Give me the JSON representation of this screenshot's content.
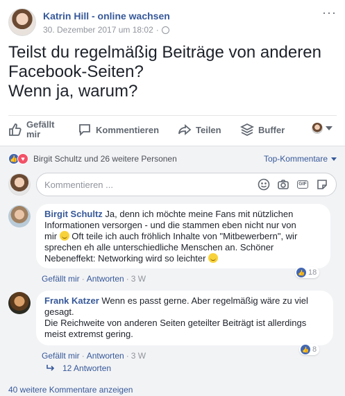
{
  "post": {
    "author": "Katrin Hill - online wachsen",
    "date": "30. Dezember 2017 um 18:02",
    "separator": "·",
    "more": "···",
    "text_lines": [
      "Teilst du regelmäßig Beiträge von anderen",
      "Facebook-Seiten?",
      "Wenn ja, warum?"
    ]
  },
  "actions": {
    "like_line1": "Gefällt",
    "like_line2": "mir",
    "comment": "Kommentieren",
    "share": "Teilen",
    "buffer": "Buffer"
  },
  "reactions": {
    "summary": "Birgit Schultz und 26 weitere Personen",
    "sort": "Top-Kommentare"
  },
  "comment_box": {
    "placeholder": "Kommentieren ..."
  },
  "comments": [
    {
      "name": "Birgit Schultz",
      "line1": " Ja, denn ich möchte meine Fans mit nützlichen",
      "line2": "Informationen versorgen - und die stammen eben nicht nur von",
      "line3a": "mir ",
      "line3b": " Oft teile ich auch fröhlich Inhalte von \"Mitbewerbern\", wir",
      "line4": "sprechen eh alle unterschiedliche Menschen an. Schöner",
      "line5": "Nebeneffekt: Networking wird so leichter ",
      "likes": "18",
      "like_label": "Gefällt mir",
      "reply_label": "Antworten",
      "dot": "·",
      "time": "3 W"
    },
    {
      "name": "Frank Katzer",
      "line1": " Wenn es passt gerne. Aber regelmäßig wäre zu viel",
      "line2": "gesagt.",
      "line3": "Die Reichweite von anderen Seiten geteilter Beiträgt ist allerdings",
      "line4": "meist extremst gering.",
      "likes": "8",
      "like_label": "Gefällt mir",
      "reply_label": "Antworten",
      "dot": "·",
      "time": "3 W"
    }
  ],
  "replies": "12 Antworten",
  "more_comments": "40 weitere Kommentare anzeigen",
  "colors": {
    "link": "#365899",
    "like_blue": "#4267b2",
    "love_red": "#f25268",
    "comment_bg": "#f2f3f5"
  }
}
